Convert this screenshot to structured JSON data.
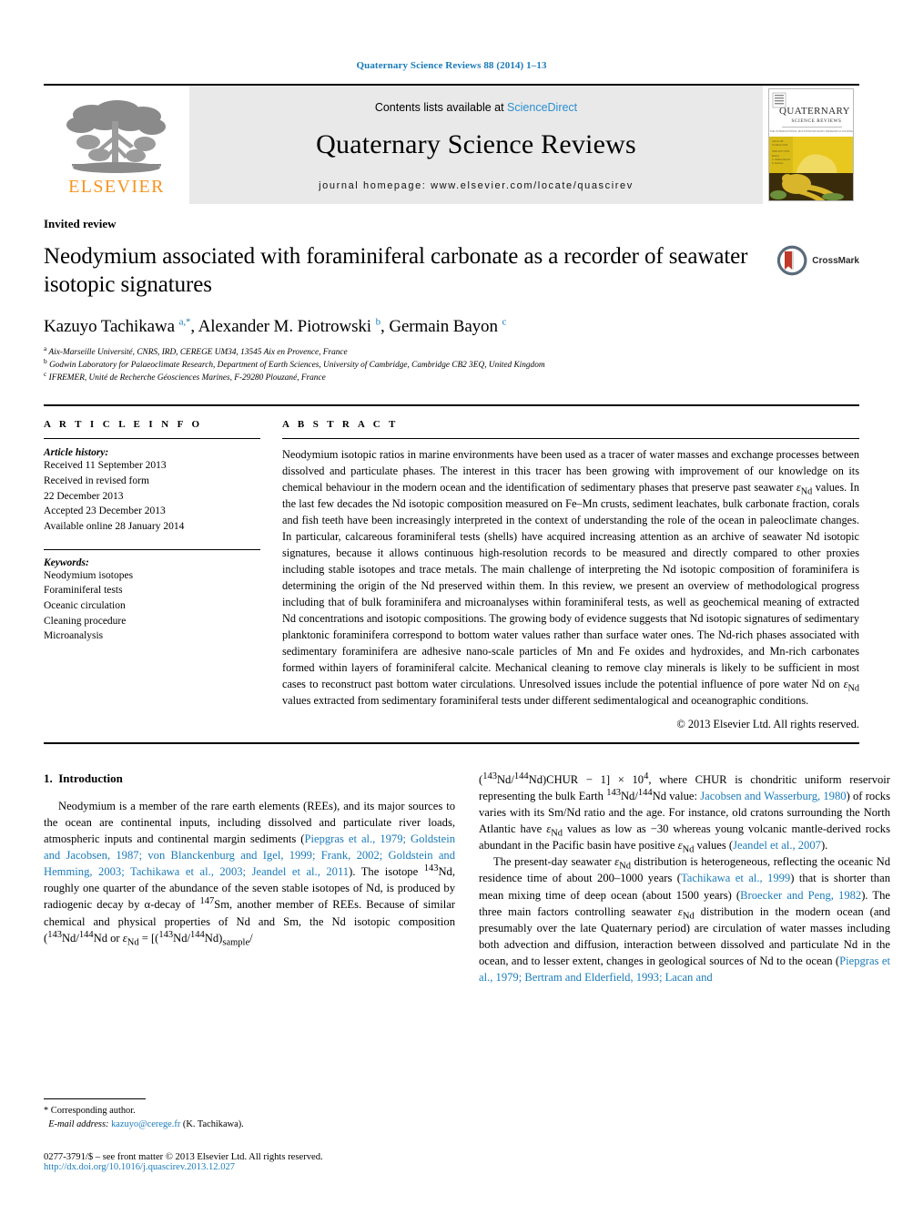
{
  "running_head": "Quaternary Science Reviews 88 (2014) 1–13",
  "masthead": {
    "publisher_word": "ELSEVIER",
    "contents_prefix": "Contents lists available at ",
    "sciencedirect": "ScienceDirect",
    "journal_title": "Quaternary Science Reviews",
    "homepage": "journal homepage: www.elsevier.com/locate/quascirev",
    "cover_title_line1": "QUATERNARY",
    "cover_title_line2": "SCIENCE REVIEWS"
  },
  "article": {
    "type_label": "Invited review",
    "title": "Neodymium associated with foraminiferal carbonate as a recorder of seawater isotopic signatures",
    "authors_html": "Kazuyo Tachikawa <sup>a,</sup><sup>*</sup>, Alexander M. Piotrowski <sup>b</sup>, Germain Bayon <sup>c</sup>",
    "affiliations": [
      "Aix-Marseille Université, CNRS, IRD, CEREGE UM34, 13545 Aix en Provence, France",
      "Godwin Laboratory for Palaeoclimate Research, Department of Earth Sciences, University of Cambridge, Cambridge CB2 3EQ, United Kingdom",
      "IFREMER, Unité de Recherche Géosciences Marines, F-29280 Plouzané, France"
    ],
    "affiliation_marks": [
      "a",
      "b",
      "c"
    ],
    "crossmark_label": "CrossMark"
  },
  "info": {
    "heading": "A R T I C L E   I N F O",
    "history_label": "Article history:",
    "history": [
      "Received 11 September 2013",
      "Received in revised form",
      "22 December 2013",
      "Accepted 23 December 2013",
      "Available online 28 January 2014"
    ],
    "keywords_label": "Keywords:",
    "keywords": [
      "Neodymium isotopes",
      "Foraminiferal tests",
      "Oceanic circulation",
      "Cleaning procedure",
      "Microanalysis"
    ]
  },
  "abstract": {
    "heading": "A B S T R A C T",
    "text_part1": "Neodymium isotopic ratios in marine environments have been used as a tracer of water masses and exchange processes between dissolved and particulate phases. The interest in this tracer has been growing with improvement of our knowledge on its chemical behaviour in the modern ocean and the identification of sedimentary phases that preserve past seawater ",
    "eps_nd": "εNd",
    "text_part2": " values. In the last few decades the Nd isotopic composition measured on Fe–Mn crusts, sediment leachates, bulk carbonate fraction, corals and fish teeth have been increasingly interpreted in the context of understanding the role of the ocean in paleoclimate changes. In particular, calcareous foraminiferal tests (shells) have acquired increasing attention as an archive of seawater Nd isotopic signatures, because it allows continuous high-resolution records to be measured and directly compared to other proxies including stable isotopes and trace metals. The main challenge of interpreting the Nd isotopic composition of foraminifera is determining the origin of the Nd preserved within them. In this review, we present an overview of methodological progress including that of bulk foraminifera and microanalyses within foraminiferal tests, as well as geochemical meaning of extracted Nd concentrations and isotopic compositions. The growing body of evidence suggests that Nd isotopic signatures of sedimentary planktonic foraminifera correspond to bottom water values rather than surface water ones. The Nd-rich phases associated with sedimentary foraminifera are adhesive nano-scale particles of Mn and Fe oxides and hydroxides, and Mn-rich carbonates formed within layers of foraminiferal calcite. Mechanical cleaning to remove clay minerals is likely to be sufficient in most cases to reconstruct past bottom water circulations. Unresolved issues include the potential influence of pore water Nd on ",
    "text_part3": " values extracted from sedimentary foraminiferal tests under different sedimentalogical and oceanographic conditions.",
    "copyright": "© 2013 Elsevier Ltd. All rights reserved."
  },
  "introduction": {
    "section_number": "1.",
    "section_title": "Introduction",
    "left_p1_a": "Neodymium is a member of the rare earth elements (REEs), and its major sources to the ocean are continental inputs, including dissolved and particulate river loads, atmospheric inputs and continental margin sediments (",
    "left_refs_1": "Piepgras et al., 1979; Goldstein and Jacobsen, 1987; von Blanckenburg and Igel, 1999; Frank, 2002; Goldstein and Hemming, 2003; Tachikawa et al., 2003; Jeandel et al., 2011",
    "left_p1_b": "). The isotope ",
    "nd143": "143",
    "left_p1_c": "Nd, roughly one quarter of the abundance of the seven stable isotopes of Nd, is produced by radiogenic decay by α-decay of ",
    "sm147": "147",
    "left_p1_d": "Sm, another member of REEs. Because of similar chemical and physical properties of Nd and Sm, the Nd isotopic composition (",
    "right_p1_a": ")CHUR − 1] × 10",
    "right_p1_b": ", where CHUR is chondritic uniform reservoir representing the bulk Earth ",
    "right_ref_jacobsen": "Jacobsen and Wasserburg, 1980",
    "right_p1_c": ") of rocks varies with its Sm/Nd ratio and the age. For instance, old cratons surrounding the North Atlantic have ",
    "right_p1_d": " values as low as −30 whereas young volcanic mantle-derived rocks abundant in the Pacific basin have positive ",
    "right_p1_e": " values (",
    "right_ref_jeandel": "Jeandel et al., 2007",
    "right_p1_f": ").",
    "right_p2_a": "The present-day seawater ",
    "right_p2_b": " distribution is heterogeneous, reflecting the oceanic Nd residence time of about 200–1000 years (",
    "right_ref_tachikawa": "Tachikawa et al., 1999",
    "right_p2_c": ") that is shorter than mean mixing time of deep ocean (about 1500 years) (",
    "right_ref_broecker": "Broecker and Peng, 1982",
    "right_p2_d": "). The three main factors controlling seawater ",
    "right_p2_e": " distribution in the modern ocean (and presumably over the late Quaternary period) are circulation of water masses including both advection and diffusion, interaction between dissolved and particulate Nd in the ocean, and to lesser extent, changes in geological sources of Nd to the ocean (",
    "right_ref_final": "Piepgras et al., 1979; Bertram and Elderfield, 1993; Lacan and"
  },
  "footer": {
    "corresponding_author": "* Corresponding author.",
    "email_label": "E-mail address:",
    "email": "kazuyo@cerege.fr",
    "email_suffix": "(K. Tachikawa).",
    "issn_line": "0277-3791/$ – see front matter © 2013 Elsevier Ltd. All rights reserved.",
    "doi_line": "http://dx.doi.org/10.1016/j.quascirev.2013.12.027"
  },
  "colors": {
    "link_blue": "#1a7bb9",
    "sciencedirect_blue": "#2b8fd0",
    "elsevier_orange": "#f7941e",
    "masthead_grey": "#e9e9e9",
    "cover_yellow": "#e8c81e"
  }
}
